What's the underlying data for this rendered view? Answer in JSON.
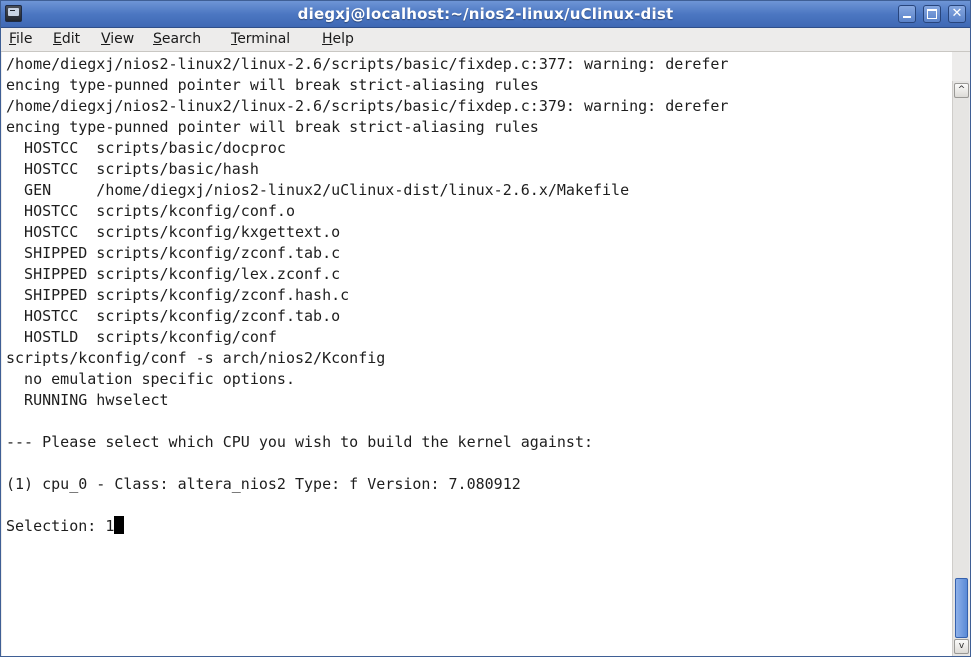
{
  "window": {
    "title": "diegxj@localhost:~/nios2-linux/uClinux-dist",
    "app_icon": "terminal-icon",
    "buttons": {
      "minimize_icon": "minimize-icon",
      "maximize_icon": "maximize-icon",
      "close_icon": "close-icon",
      "close_glyph": "✕"
    }
  },
  "menu": {
    "items": [
      {
        "mnemonic": "F",
        "rest": "ile"
      },
      {
        "mnemonic": "E",
        "rest": "dit"
      },
      {
        "mnemonic": "V",
        "rest": "iew"
      },
      {
        "mnemonic": "S",
        "rest": "earch"
      },
      {
        "mnemonic": "T",
        "rest": "erminal"
      },
      {
        "mnemonic": "H",
        "rest": "elp"
      }
    ]
  },
  "terminal": {
    "lines": [
      "/home/diegxj/nios2-linux2/linux-2.6/scripts/basic/fixdep.c:377: warning: derefer",
      "encing type-punned pointer will break strict-aliasing rules",
      "/home/diegxj/nios2-linux2/linux-2.6/scripts/basic/fixdep.c:379: warning: derefer",
      "encing type-punned pointer will break strict-aliasing rules",
      "  HOSTCC  scripts/basic/docproc",
      "  HOSTCC  scripts/basic/hash",
      "  GEN     /home/diegxj/nios2-linux2/uClinux-dist/linux-2.6.x/Makefile",
      "  HOSTCC  scripts/kconfig/conf.o",
      "  HOSTCC  scripts/kconfig/kxgettext.o",
      "  SHIPPED scripts/kconfig/zconf.tab.c",
      "  SHIPPED scripts/kconfig/lex.zconf.c",
      "  SHIPPED scripts/kconfig/zconf.hash.c",
      "  HOSTCC  scripts/kconfig/zconf.tab.o",
      "  HOSTLD  scripts/kconfig/conf",
      "scripts/kconfig/conf -s arch/nios2/Kconfig",
      "  no emulation specific options.",
      "  RUNNING hwselect",
      "",
      "--- Please select which CPU you wish to build the kernel against:",
      "",
      "(1) cpu_0 - Class: altera_nios2 Type: f Version: 7.080912",
      ""
    ],
    "prompt": "Selection: ",
    "input_value": "1",
    "cursor": "block-cursor"
  },
  "scrollbar": {
    "up_glyph": "^",
    "down_glyph": "v",
    "position_fraction": 1.0
  },
  "colors": {
    "titlebar": "#4c77c2",
    "terminal_bg": "#ffffff",
    "terminal_fg": "#1e1e1e",
    "scroll_thumb": "#5a8ad6"
  }
}
